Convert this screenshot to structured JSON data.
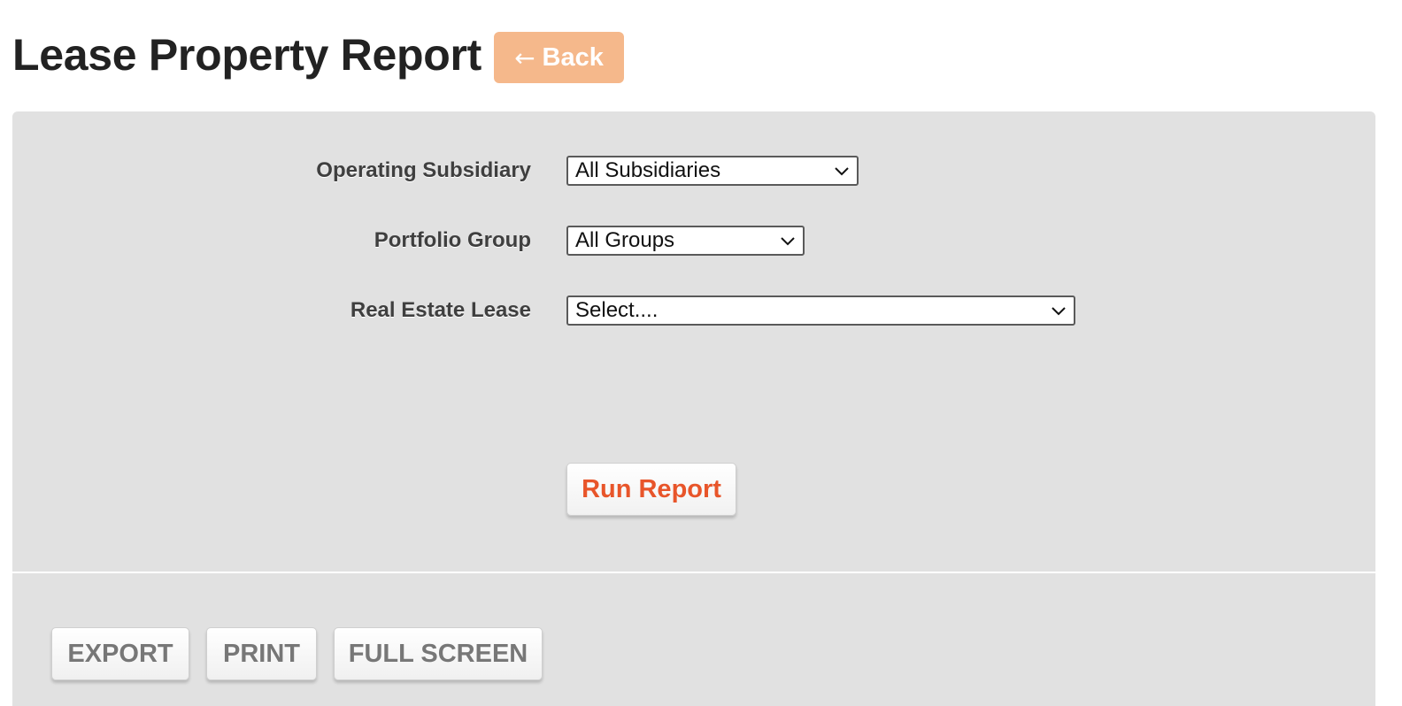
{
  "header": {
    "title": "Lease Property Report",
    "back_label": "Back",
    "back_arrow": "←",
    "back_color": "#f5b88b"
  },
  "form": {
    "fields": [
      {
        "label": "Operating Subsidiary",
        "value": "All Subsidiaries"
      },
      {
        "label": "Portfolio Group",
        "value": "All Groups"
      },
      {
        "label": "Real Estate Lease",
        "value": "Select...."
      }
    ],
    "run_label": "Run Report",
    "run_color": "#e8552a",
    "panel_color": "#e1e1e1"
  },
  "toolbar": {
    "export_label": "EXPORT",
    "print_label": "PRINT",
    "fullscreen_label": "FULL SCREEN"
  },
  "icons": {
    "select_arrow": "chevron-down-icon"
  }
}
